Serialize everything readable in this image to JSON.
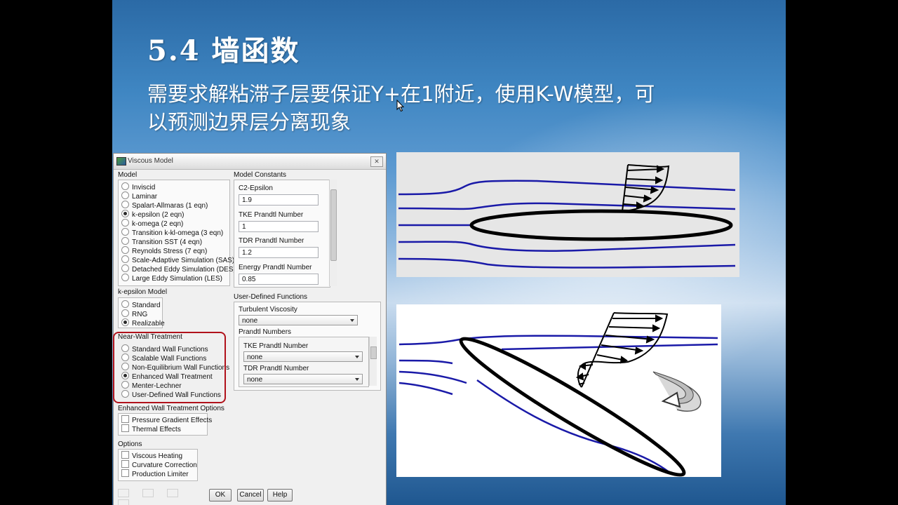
{
  "slide": {
    "title": "5.4 墙函数",
    "body_line1": "需要求解粘滞子层要保证Y+在1附近，使用K-W模型，可",
    "body_line2": "以预测边界层分离现象"
  },
  "dialog": {
    "title": "Viscous Model",
    "model": {
      "label": "Model",
      "options": [
        "Inviscid",
        "Laminar",
        "Spalart-Allmaras (1 eqn)",
        "k-epsilon (2 eqn)",
        "k-omega (2 eqn)",
        "Transition k-kl-omega (3 eqn)",
        "Transition SST (4 eqn)",
        "Reynolds Stress (7 eqn)",
        "Scale-Adaptive Simulation (SAS)",
        "Detached Eddy Simulation (DES)",
        "Large Eddy Simulation (LES)"
      ],
      "selected": 3
    },
    "kepsilon": {
      "label": "k-epsilon Model",
      "options": [
        "Standard",
        "RNG",
        "Realizable"
      ],
      "selected": 2
    },
    "nearwall": {
      "label": "Near-Wall Treatment",
      "options": [
        "Standard Wall Functions",
        "Scalable Wall Functions",
        "Non-Equilibrium Wall Functions",
        "Enhanced Wall Treatment",
        "Menter-Lechner",
        "User-Defined Wall Functions"
      ],
      "selected": 3
    },
    "ewt": {
      "label": "Enhanced Wall Treatment Options",
      "options": [
        "Pressure Gradient Effects",
        "Thermal Effects"
      ]
    },
    "options": {
      "label": "Options",
      "items": [
        "Viscous Heating",
        "Curvature Correction",
        "Production Limiter"
      ]
    },
    "constants": {
      "label": "Model Constants",
      "items": [
        {
          "name": "C2-Epsilon",
          "value": "1.9"
        },
        {
          "name": "TKE Prandtl Number",
          "value": "1"
        },
        {
          "name": "TDR Prandtl Number",
          "value": "1.2"
        },
        {
          "name": "Energy Prandtl Number",
          "value": "0.85"
        }
      ]
    },
    "udf": {
      "label": "User-Defined Functions",
      "turb_visc_label": "Turbulent Viscosity",
      "turb_visc_value": "none",
      "prandtl_label": "Prandtl Numbers",
      "tke_label": "TKE Prandtl Number",
      "tke_value": "none",
      "tdr_label": "TDR Prandtl Number",
      "tdr_value": "none"
    },
    "buttons": {
      "ok": "OK",
      "cancel": "Cancel",
      "help": "Help"
    }
  },
  "colors": {
    "streamline": "#1a1aa8",
    "highlight": "#b0121b"
  }
}
